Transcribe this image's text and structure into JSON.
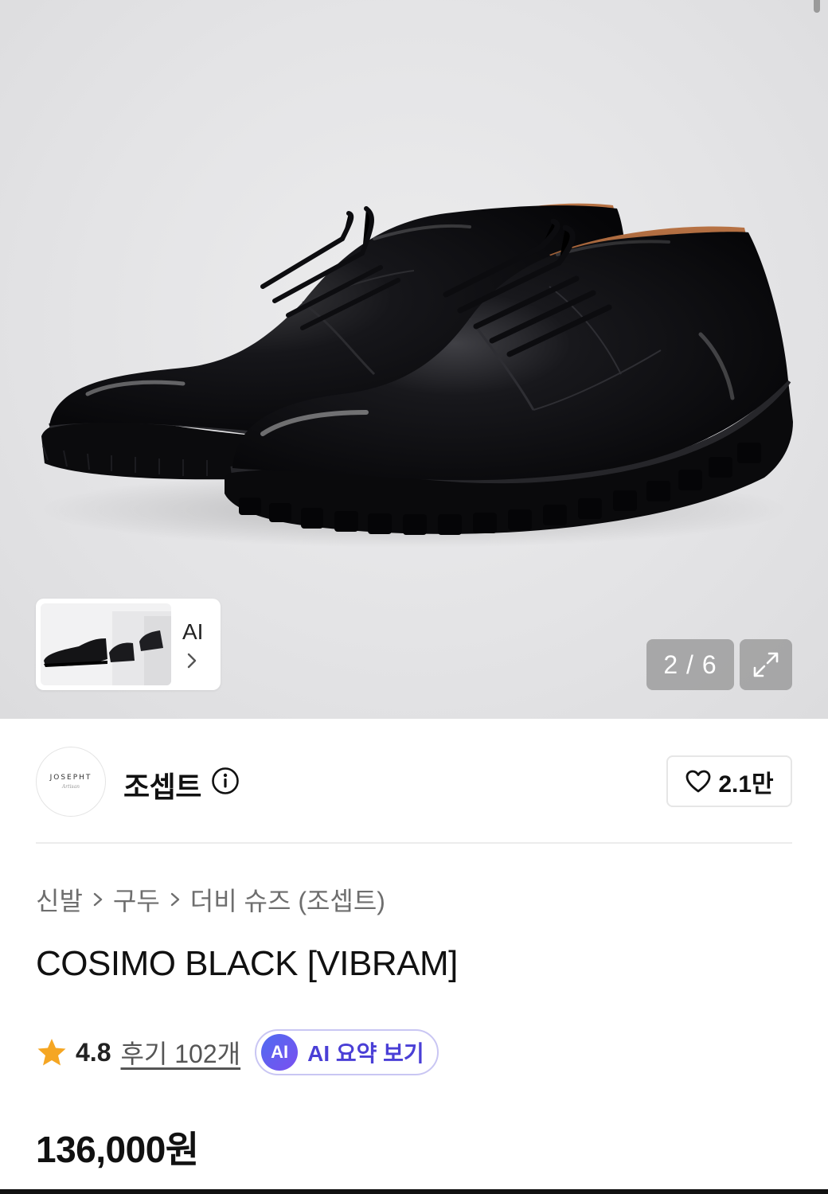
{
  "gallery": {
    "thumbnail_label": "AI",
    "counter": "2 / 6",
    "current_index": 2,
    "total": 6
  },
  "brand": {
    "logo_text": "JOSEPHT",
    "logo_subtext": "Artisan",
    "name": "조셉트",
    "likes": "2.1만"
  },
  "breadcrumb": [
    "신발",
    "구두",
    "더비 슈즈 (조셉트)"
  ],
  "product": {
    "title": "COSIMO BLACK [VIBRAM]",
    "rating": "4.8",
    "reviews": "후기 102개",
    "ai_badge": "AI",
    "ai_summary": "AI 요약 보기",
    "price": "136,000원"
  },
  "colors": {
    "accent": "#4a3fd6",
    "star": "#f5a623",
    "gallery_bg": "#e4e4e6"
  },
  "icons": {
    "info": "info-icon",
    "heart": "heart-icon",
    "expand": "expand-icon",
    "chevron": "chevron-right-icon",
    "star": "star-icon"
  }
}
